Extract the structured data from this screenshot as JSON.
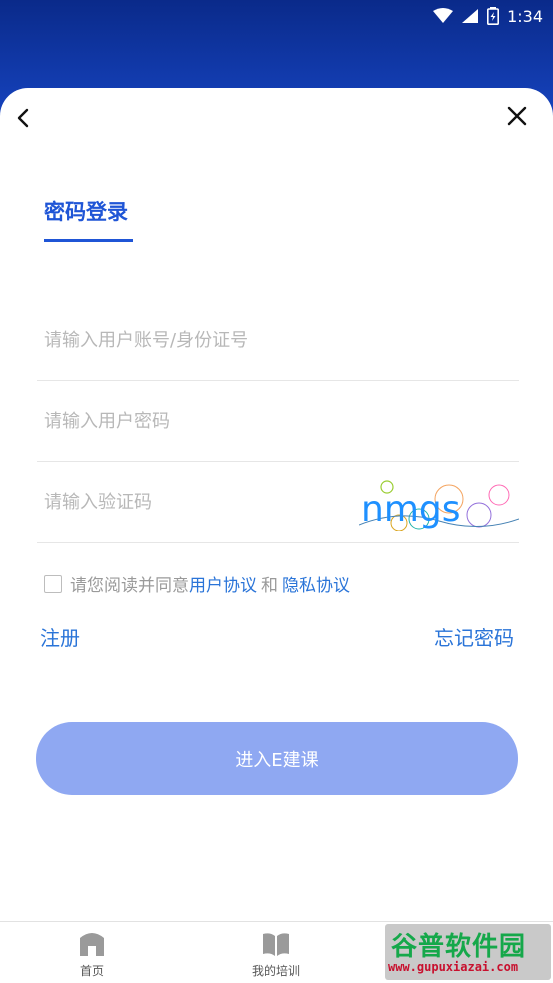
{
  "status_bar": {
    "time": "1:34"
  },
  "tabs": [
    {
      "label": "密码登录",
      "active": true
    }
  ],
  "form": {
    "account_placeholder": "请输入用户账号/身份证号",
    "password_placeholder": "请输入用户密码",
    "captcha_placeholder": "请输入验证码",
    "captcha_text": "nmgs"
  },
  "agreement": {
    "prefix": "请您阅读并同意",
    "user_agreement": "用户协议",
    "and": "和",
    "privacy_policy": "隐私协议",
    "checked": false
  },
  "links": {
    "register": "注册",
    "forgot_password": "忘记密码"
  },
  "submit_label": "进入E建课",
  "bottom_nav": [
    {
      "label": "首页",
      "icon": "home-icon"
    },
    {
      "label": "我的培训",
      "icon": "book-icon"
    }
  ],
  "watermark": {
    "title": "谷普软件园",
    "url": "www.gupuxiazai.com"
  },
  "colors": {
    "primary": "#1f55d6",
    "link": "#2a74d8",
    "button": "#8fa8f2",
    "header_bg": "#1848c8"
  }
}
